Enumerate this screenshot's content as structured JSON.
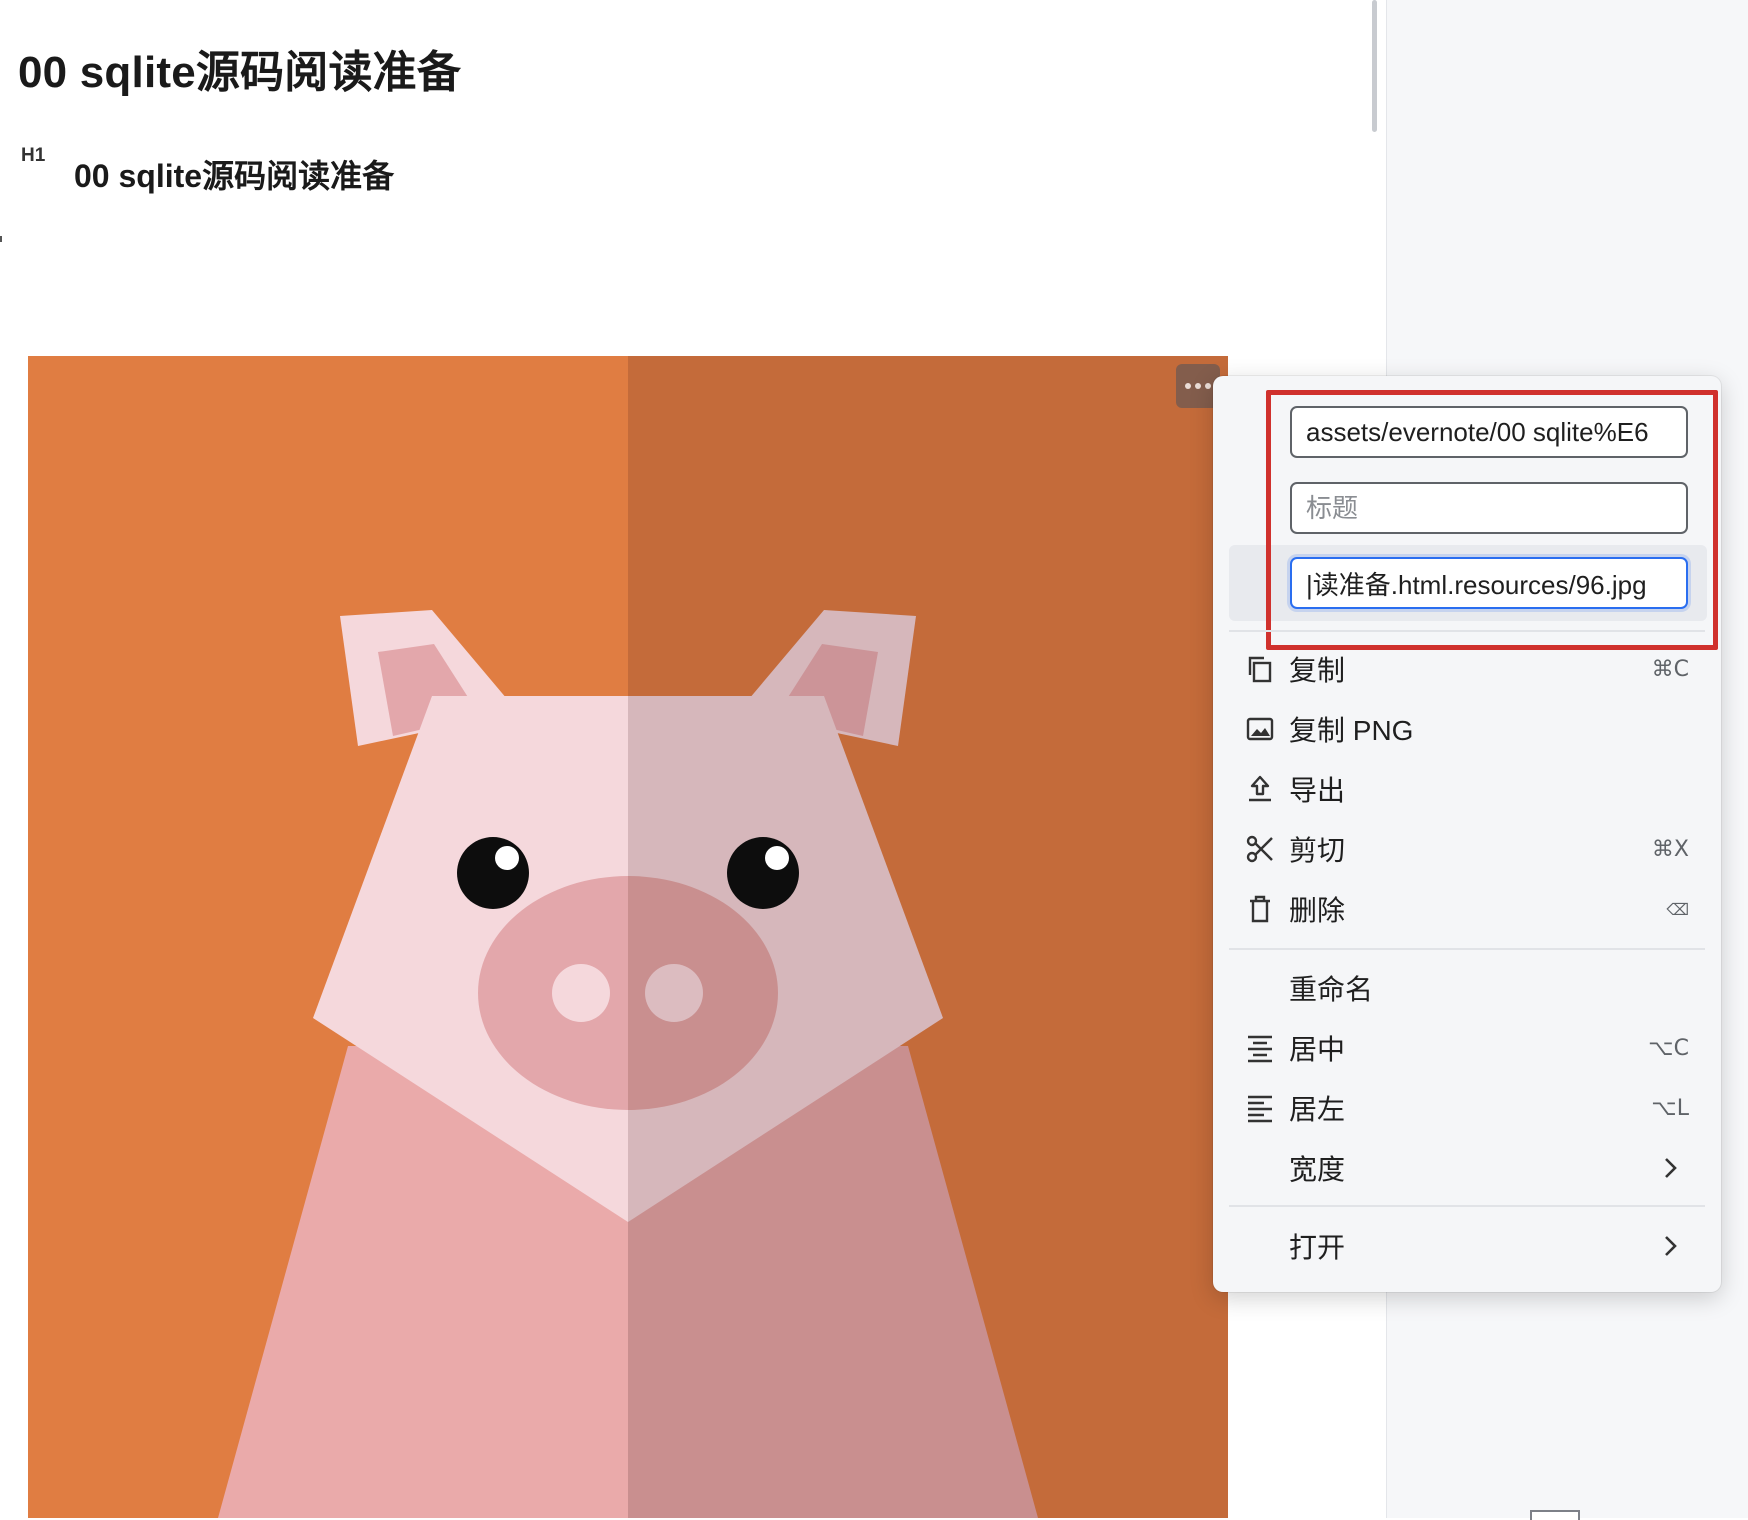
{
  "document": {
    "title": "00 sqlite源码阅读准备",
    "heading_badge": "H1",
    "heading_text": "00 sqlite源码阅读准备"
  },
  "image_menu": {
    "more_icon": "ellipsis-icon",
    "fields": {
      "src_value": "assets/evernote/00 sqlite%E6",
      "title_placeholder": "标题",
      "alt_value": "|读准备.html.resources/96.jpg"
    },
    "items": [
      {
        "label": "复制",
        "shortcut": "⌘C",
        "icon": "copy-icon"
      },
      {
        "label": "复制 PNG",
        "shortcut": "",
        "icon": "image-icon"
      },
      {
        "label": "导出",
        "shortcut": "",
        "icon": "export-icon"
      },
      {
        "label": "剪切",
        "shortcut": "⌘X",
        "icon": "scissors-icon"
      },
      {
        "label": "删除",
        "shortcut": "⌫",
        "icon": "trash-icon"
      },
      {
        "label": "重命名",
        "shortcut": "",
        "icon": ""
      },
      {
        "label": "居中",
        "shortcut": "⌥C",
        "icon": "align-center-icon"
      },
      {
        "label": "居左",
        "shortcut": "⌥L",
        "icon": "align-left-icon"
      },
      {
        "label": "宽度",
        "shortcut": "",
        "icon": "chevron-right-icon"
      },
      {
        "label": "打开",
        "shortcut": "",
        "icon": "chevron-right-icon"
      }
    ]
  },
  "colors": {
    "highlight": "#d0312d",
    "focus": "#2a6ef0",
    "image_bg_left": "#e07d42",
    "image_bg_right": "#c46b3a"
  }
}
